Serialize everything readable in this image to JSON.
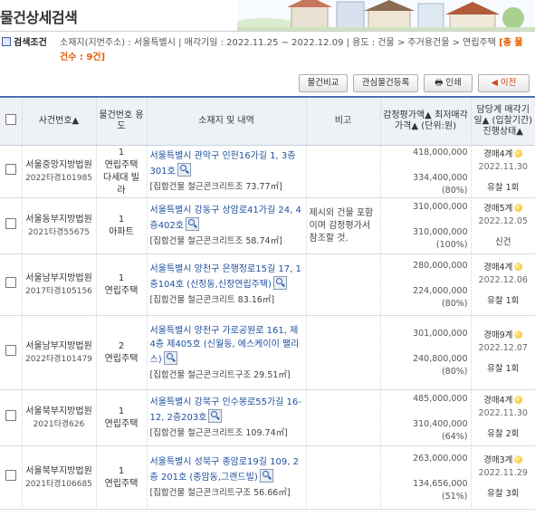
{
  "header": {
    "title": "물건상세검색"
  },
  "conditions": {
    "label": "검색조건",
    "text": "소재지(지번주소) : 서울특별시 | 매각기일 : 2022.11.25 ~ 2022.12.09 | 용도 : 건물 > 주거용건물 > 연립주택",
    "count": "[총 물건수 : 9건]"
  },
  "toolbar": {
    "compare": "물건비교",
    "interest": "관심물건등록",
    "print": "인쇄",
    "prev": "◀ 이전"
  },
  "table": {
    "headers": {
      "case": "사건번호▲",
      "item": "물건번호 용도",
      "address": "소재지 및 내역",
      "note": "비고",
      "price": "감정평가액▲ 최저매각가격▲ (단위:원)",
      "sale": "담당계 매각기일▲ (입찰기간) 진행상태▲"
    },
    "rows": [
      {
        "court": "서울중앙지방법원",
        "case_no": "2022타경101985",
        "item_no": "1",
        "usage": "연립주택 다세대 빌라",
        "addr": "서울특별시 관악구 인헌16가길 1, 3층 301호",
        "detail": "[집합건물 철근콘크리트조 73.77㎡]",
        "note": "",
        "appraisal": "418,000,000",
        "min_price": "334,400,000",
        "ratio": "(80%)",
        "stage": "경매4계",
        "date": "2022.11.30",
        "status": "유찰 1회"
      },
      {
        "court": "서울동부지방법원",
        "case_no": "2021타경55675",
        "item_no": "1",
        "usage": "아파트",
        "addr": "서울특별시 강동구 상암로41가길 24, 4층402호",
        "detail": "[집합건물 철근콘크리트조 58.74㎡]",
        "note": "제시외 건물 포함이며 감정평가서 참조할 것.",
        "appraisal": "310,000,000",
        "min_price": "310,000,000",
        "ratio": "(100%)",
        "stage": "경매5계",
        "date": "2022.12.05",
        "status": "신건"
      },
      {
        "court": "서울남부지방법원",
        "case_no": "2017타경105156",
        "item_no": "1",
        "usage": "연립주택",
        "addr": "서울특별시 양천구 은행정로15길 17, 1층104호 (신정동,신정연립주택)",
        "detail": "[집합건물 철근콘크리트 83.16㎡]",
        "note": "",
        "appraisal": "280,000,000",
        "min_price": "224,000,000",
        "ratio": "(80%)",
        "stage": "경매4계",
        "date": "2022.12.06",
        "status": "유찰 1회"
      },
      {
        "court": "서울남부지방법원",
        "case_no": "2022타경101479",
        "item_no": "2",
        "usage": "연립주택",
        "addr": "서울특별시 양천구 가로공원로 161, 제4층 제405호 (신월동, 에스케이이 팰리스)",
        "detail": "[집합건물 철근콘크리트구조 29.51㎡]",
        "note": "",
        "appraisal": "301,000,000",
        "min_price": "240,800,000",
        "ratio": "(80%)",
        "stage": "경매9계",
        "date": "2022.12.07",
        "status": "유찰 1회"
      },
      {
        "court": "서울북부지방법원",
        "case_no": "2021타경626",
        "item_no": "1",
        "usage": "연립주택",
        "addr": "서울특별시 강북구 인수봉로55가길 16-12, 2층203호",
        "detail": "[집합건물 철근콘크리트조 109.74㎡]",
        "note": "",
        "appraisal": "485,000,000",
        "min_price": "310,400,000",
        "ratio": "(64%)",
        "stage": "경매4계",
        "date": "2022.11.30",
        "status": "유찰 2회"
      },
      {
        "court": "서울북부지방법원",
        "case_no": "2021타경106685",
        "item_no": "1",
        "usage": "연립주택",
        "addr": "서울특별시 성북구 종암로19길 109, 2층 201호 (종암동,그랜드빌)",
        "detail": "[집합건물 철근콘크리트구조 56.66㎡]",
        "note": "",
        "appraisal": "263,000,000",
        "min_price": "134,656,000",
        "ratio": "(51%)",
        "stage": "경매3계",
        "date": "2022.11.29",
        "status": "유찰 3회"
      }
    ]
  }
}
